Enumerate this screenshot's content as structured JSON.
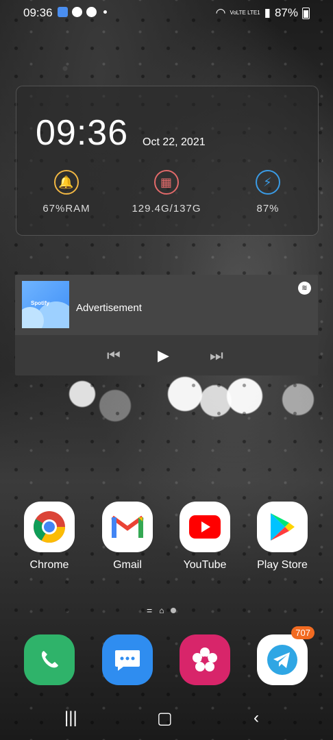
{
  "status_bar": {
    "time": "09:36",
    "network": "VoLTE LTE1",
    "battery": "87%"
  },
  "clock_widget": {
    "time": "09:36",
    "date": "Oct 22, 2021",
    "stats": [
      {
        "label": "67%RAM",
        "icon": "bell-icon",
        "color": "#f1b743"
      },
      {
        "label": "129.4G/137G",
        "icon": "broom-icon",
        "color": "#e26a6a"
      },
      {
        "label": "87%",
        "icon": "battery-icon",
        "color": "#3a9be5"
      }
    ]
  },
  "music_widget": {
    "title": "Advertisement",
    "album_label": "Spotify"
  },
  "apps": [
    {
      "label": "Chrome",
      "icon": "chrome-icon"
    },
    {
      "label": "Gmail",
      "icon": "gmail-icon"
    },
    {
      "label": "YouTube",
      "icon": "youtube-icon"
    },
    {
      "label": "Play Store",
      "icon": "play-store-icon"
    }
  ],
  "dock": [
    {
      "icon": "phone-icon",
      "color": "#2fb36a"
    },
    {
      "icon": "messages-icon",
      "color": "#2f8df0"
    },
    {
      "icon": "gallery-icon",
      "color": "#d8256a"
    },
    {
      "icon": "telegram-icon",
      "color": "#2fa6e4",
      "badge": "707"
    }
  ]
}
